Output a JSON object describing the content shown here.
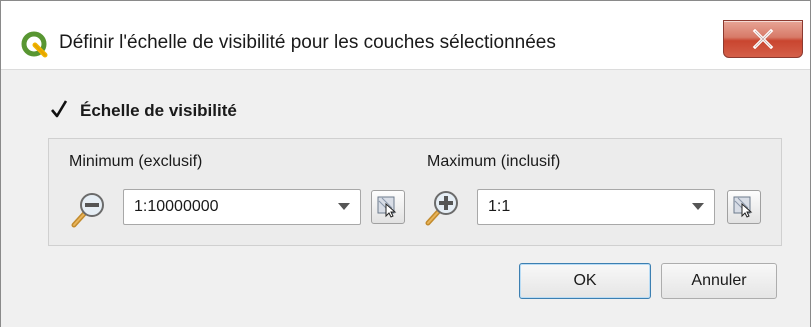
{
  "window": {
    "title": "Définir l'échelle de visibilité pour les couches sélectionnées",
    "app_icon": "qgis-logo-icon",
    "close_icon": "close-icon"
  },
  "visibility": {
    "checked": true,
    "label": "Échelle de visibilité"
  },
  "minimum": {
    "label": "Minimum (exclusif)",
    "icon": "zoom-out-icon",
    "value": "1:10000000"
  },
  "maximum": {
    "label": "Maximum (inclusif)",
    "icon": "zoom-in-icon",
    "value": "1:1"
  },
  "buttons": {
    "ok": "OK",
    "cancel": "Annuler"
  }
}
